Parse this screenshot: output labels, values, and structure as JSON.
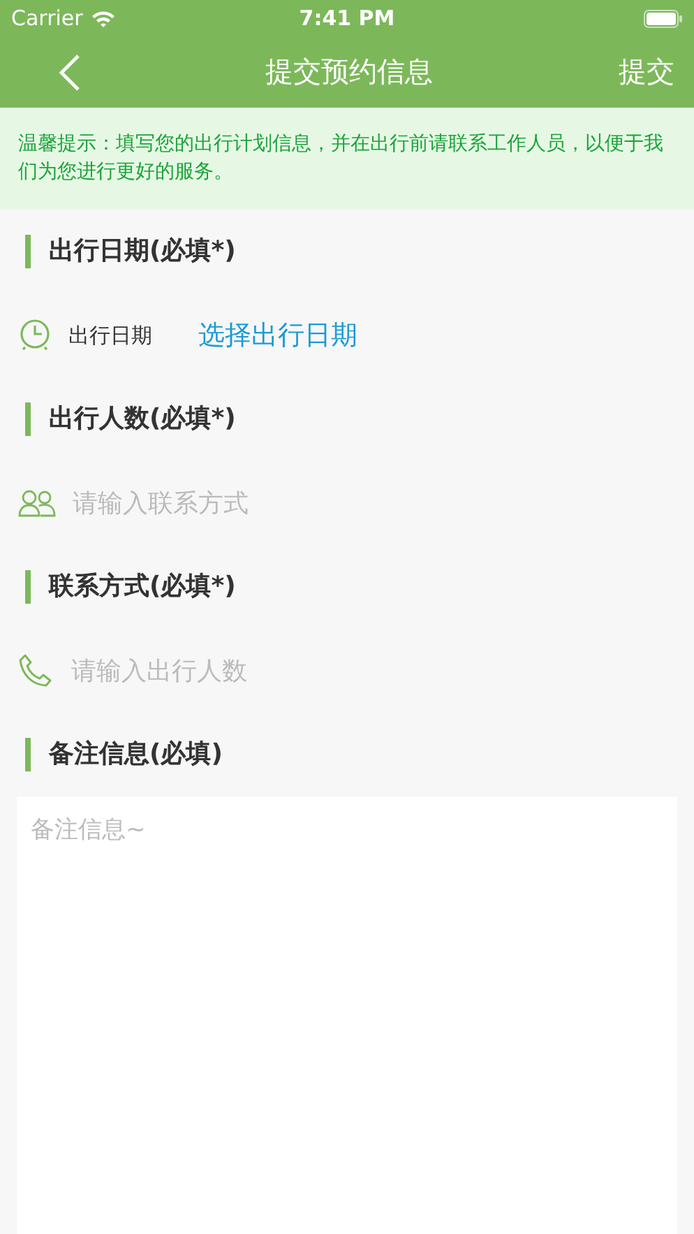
{
  "status_bar": {
    "carrier": "Carrier",
    "time": "7:41 PM"
  },
  "nav": {
    "title": "提交预约信息",
    "action": "提交"
  },
  "notice": "温馨提示：填写您的出行计划信息，并在出行前请联系工作人员，以便于我们为您进行更好的服务。",
  "sections": [
    {
      "heading": "出行日期(必填*)",
      "kind": "date",
      "label": "出行日期",
      "link": "选择出行日期"
    },
    {
      "heading": "出行人数(必填*)",
      "kind": "people",
      "placeholder": "请输入联系方式"
    },
    {
      "heading": "联系方式(必填*)",
      "kind": "phone",
      "placeholder": "请输入出行人数"
    }
  ],
  "notes": {
    "heading": "备注信息(必填)",
    "placeholder": "备注信息~"
  }
}
